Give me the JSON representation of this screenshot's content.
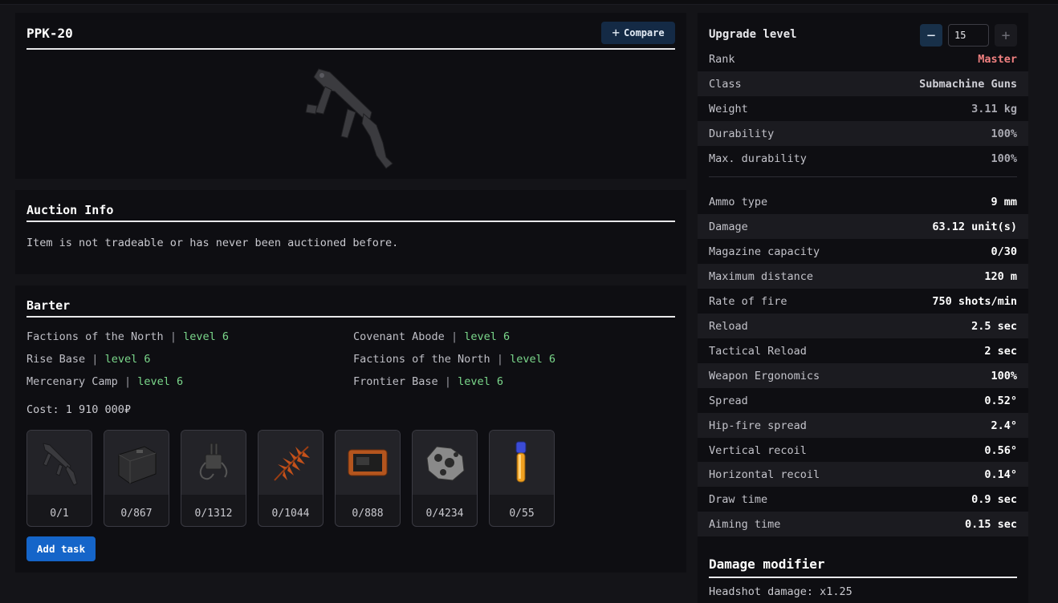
{
  "item": {
    "title": "PPK-20",
    "compare_label": "Compare",
    "weapon_icon": "submachine-gun-icon"
  },
  "auction": {
    "title": "Auction Info",
    "text": "Item is not tradeable or has never been auctioned before."
  },
  "barter": {
    "title": "Barter",
    "separator": "|",
    "locations": [
      {
        "name": "Factions of the North",
        "level": "level 6"
      },
      {
        "name": "Covenant Abode",
        "level": "level 6"
      },
      {
        "name": "Rise Base",
        "level": "level 6"
      },
      {
        "name": "Factions of the North",
        "level": "level 6"
      },
      {
        "name": "Mercenary Camp",
        "level": "level 6"
      },
      {
        "name": "Frontier Base",
        "level": "level 6"
      }
    ],
    "cost": "Cost: 1 910 000₽",
    "items": [
      {
        "icon": "smg-icon",
        "count": "0/1"
      },
      {
        "icon": "ammo-box-icon",
        "count": "0/867"
      },
      {
        "icon": "electronics-icon",
        "count": "0/1312"
      },
      {
        "icon": "fern-leaf-icon",
        "count": "0/1044"
      },
      {
        "icon": "tablet-icon",
        "count": "0/888"
      },
      {
        "icon": "ore-chunk-icon",
        "count": "0/4234"
      },
      {
        "icon": "vial-icon",
        "count": "0/55"
      }
    ],
    "add_task_label": "Add task"
  },
  "stats": {
    "upgrade_label": "Upgrade level",
    "upgrade_value": "15",
    "minus": "−",
    "plus": "+",
    "rows": [
      {
        "label": "Rank",
        "value": "Master"
      },
      {
        "label": "Class",
        "value": "Submachine Guns"
      },
      {
        "label": "Weight",
        "value": "3.11 kg"
      },
      {
        "label": "Durability",
        "value": "100%"
      },
      {
        "label": "Max. durability",
        "value": "100%"
      },
      {
        "label": "Ammo type",
        "value": "9 mm"
      },
      {
        "label": "Damage",
        "value": "63.12 unit(s)"
      },
      {
        "label": "Magazine capacity",
        "value": "0/30"
      },
      {
        "label": "Maximum distance",
        "value": "120 m"
      },
      {
        "label": "Rate of fire",
        "value": "750 shots/min"
      },
      {
        "label": "Reload",
        "value": "2.5 sec"
      },
      {
        "label": "Tactical Reload",
        "value": "2 sec"
      },
      {
        "label": "Weapon Ergonomics",
        "value": "100%"
      },
      {
        "label": "Spread",
        "value": "0.52°"
      },
      {
        "label": "Hip-fire spread",
        "value": "2.4°"
      },
      {
        "label": "Vertical recoil",
        "value": "0.56°"
      },
      {
        "label": "Horizontal recoil",
        "value": "0.14°"
      },
      {
        "label": "Draw time",
        "value": "0.9 sec"
      },
      {
        "label": "Aiming time",
        "value": "0.15 sec"
      }
    ],
    "damage_modifier_title": "Damage modifier",
    "headshot": "Headshot damage: x1.25"
  },
  "colors": {
    "accent_button": "#1565c9",
    "level_green": "#7bd88b",
    "rank_master": "#f08080"
  }
}
